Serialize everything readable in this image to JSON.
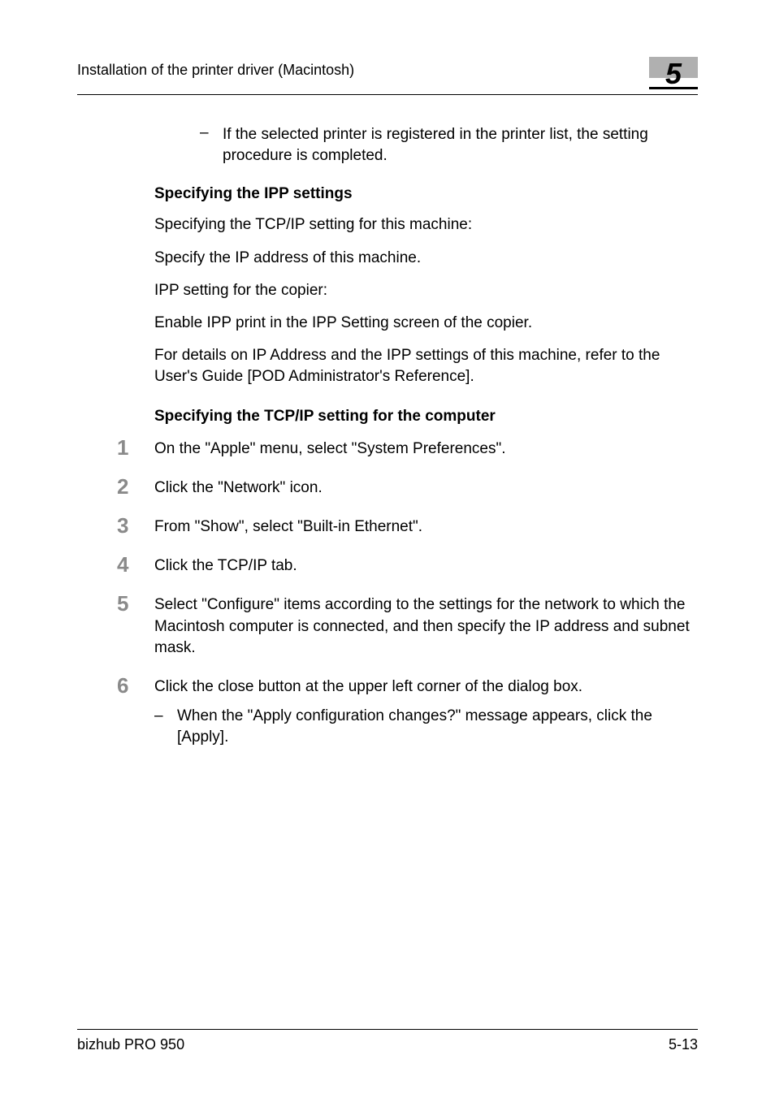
{
  "header": {
    "title": "Installation of the printer driver (Macintosh)",
    "chapter": "5"
  },
  "intro_bullet": "If the selected printer is registered in the printer list, the setting procedure is completed.",
  "section1": {
    "heading": "Specifying the IPP settings",
    "p1": "Specifying the TCP/IP setting for this machine:",
    "p2": "Specify the IP address of this machine.",
    "p3": "IPP setting for the copier:",
    "p4": "Enable IPP print in the IPP Setting screen of the copier.",
    "p5": "For details on IP Address and the IPP settings of this machine, refer to the User's Guide [POD Administrator's Reference]."
  },
  "section2": {
    "heading": "Specifying the TCP/IP setting for the computer",
    "steps": {
      "s1": "On the \"Apple\" menu, select \"System Preferences\".",
      "s2": "Click the \"Network\" icon.",
      "s3": "From \"Show\", select \"Built-in Ethernet\".",
      "s4": "Click the TCP/IP tab.",
      "s5": "Select \"Configure\" items according to the settings for the network to which the Macintosh computer is connected, and then specify the IP address and subnet mask.",
      "s6": "Click the close button at the upper left corner of the dialog box.",
      "s6_sub": "When the \"Apply configuration changes?\" message appears, click the [Apply]."
    },
    "nums": {
      "n1": "1",
      "n2": "2",
      "n3": "3",
      "n4": "4",
      "n5": "5",
      "n6": "6"
    }
  },
  "footer": {
    "product": "bizhub PRO 950",
    "page": "5-13"
  },
  "dash": "–"
}
